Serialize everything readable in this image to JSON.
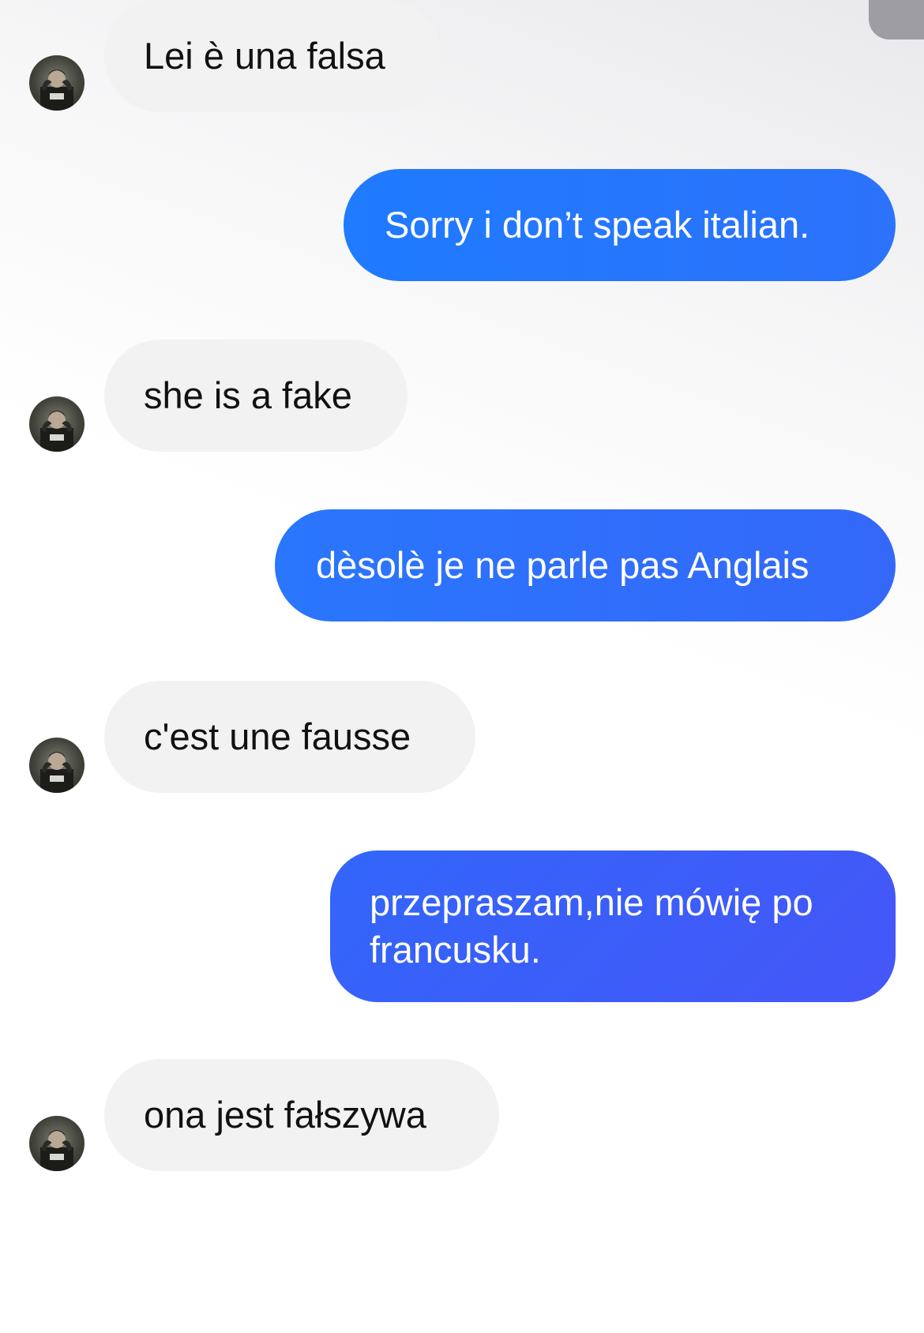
{
  "conversation": {
    "messages": [
      {
        "direction": "incoming",
        "text": "Lei è una falsa"
      },
      {
        "direction": "outgoing",
        "text": "Sorry i don’t speak italian."
      },
      {
        "direction": "incoming",
        "text": "she is a fake"
      },
      {
        "direction": "outgoing",
        "text": "dèsolè je ne parle pas Anglais"
      },
      {
        "direction": "incoming",
        "text": "c'est une fausse"
      },
      {
        "direction": "outgoing",
        "text": "przepraszam,nie mówię po francusku."
      },
      {
        "direction": "incoming",
        "text": "ona jest fałszywa"
      }
    ]
  },
  "theme": {
    "incoming_bubble": "#f2f2f3",
    "outgoing_gradient": [
      "#1f7bff",
      "#4a4df7"
    ],
    "avatar_icon": "contact-photo"
  }
}
